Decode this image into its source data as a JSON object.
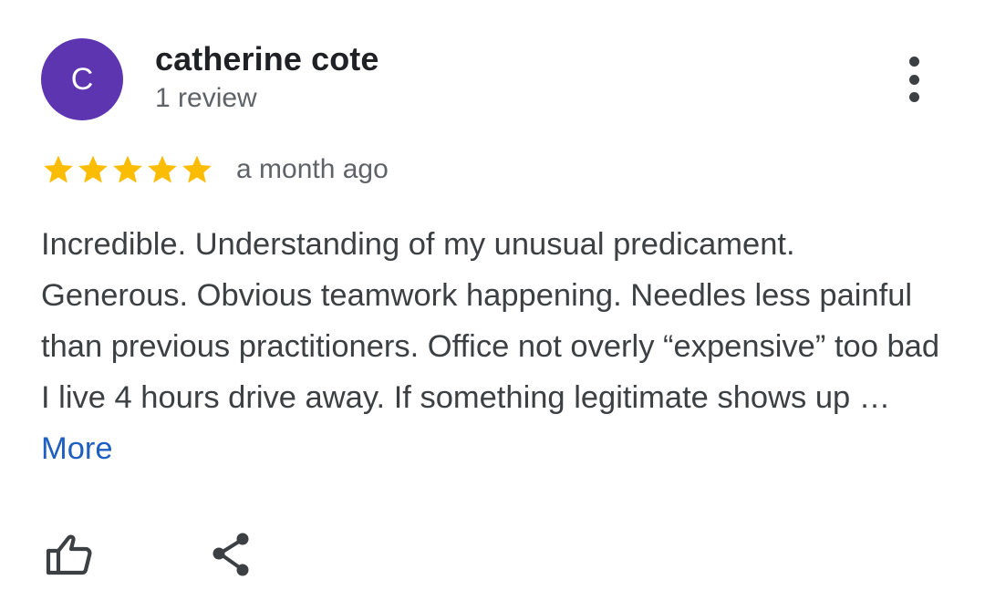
{
  "reviewer": {
    "avatar_letter": "C",
    "avatar_color": "#5e35b1",
    "name": "catherine cote",
    "review_count": "1 review"
  },
  "menu": {
    "icon": "more-vert-icon"
  },
  "rating": {
    "stars": 5,
    "max_stars": 5,
    "star_color": "#fbbc04",
    "time_ago": "a month ago"
  },
  "review": {
    "text": "Incredible. Understanding of my unusual predicament. Generous. Obvious teamwork happening. Needles less painful than previous practitioners. Office not overly “expensive” too bad I live 4 hours drive away. If something legitimate shows up … ",
    "more_label": "More",
    "link_color": "#1f5fbf"
  },
  "actions": {
    "like_icon": "thumb-up-icon",
    "share_icon": "share-icon"
  }
}
